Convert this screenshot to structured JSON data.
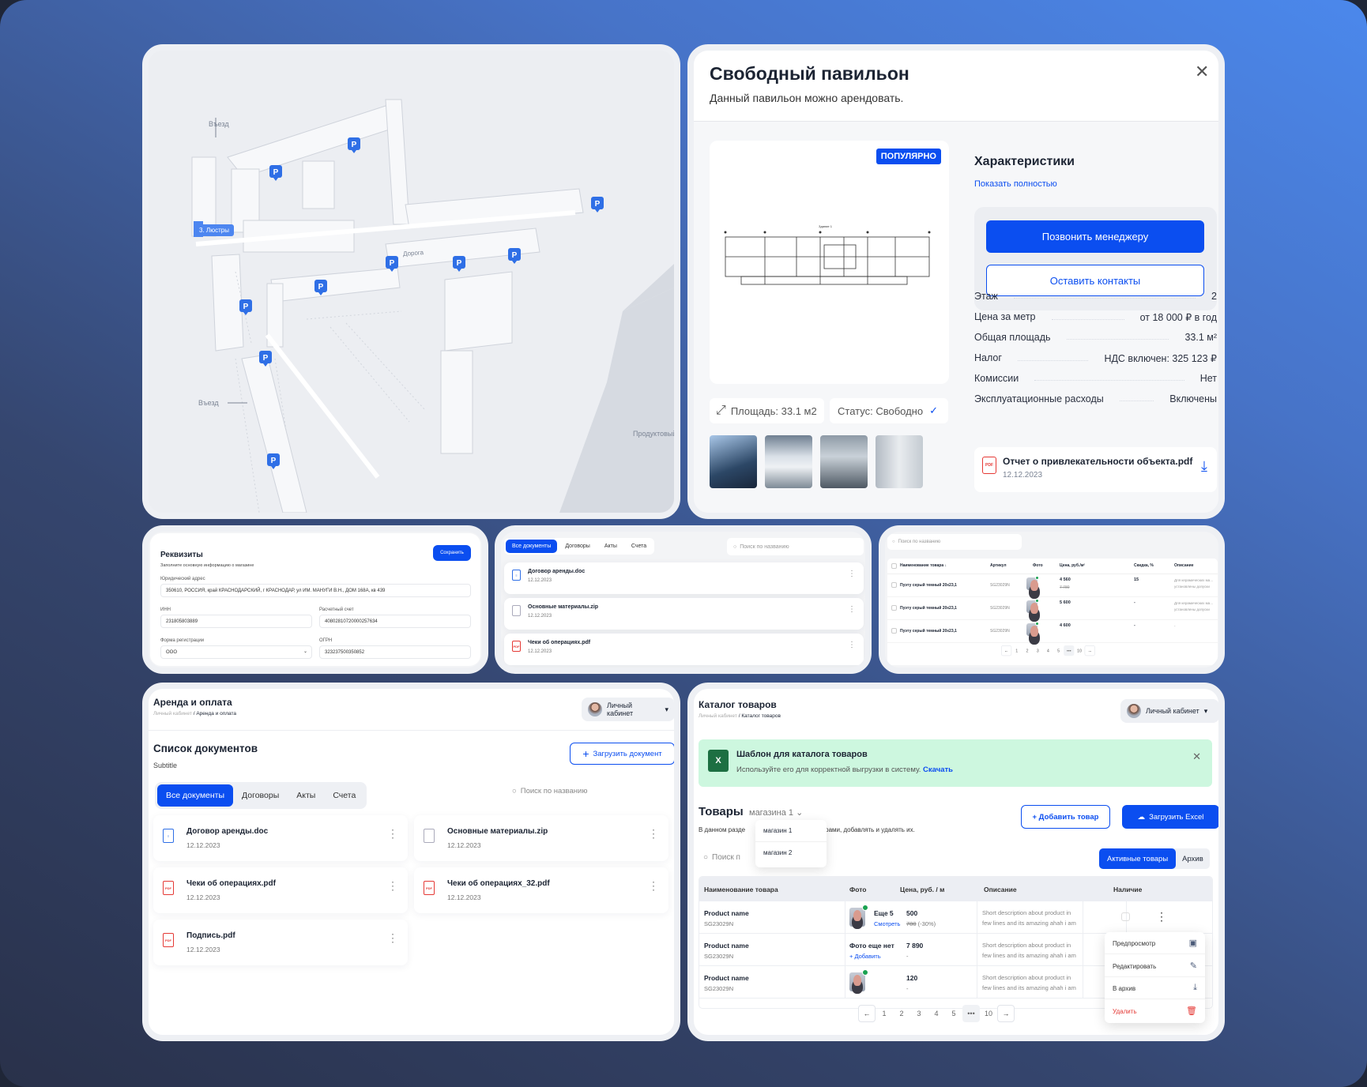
{
  "map": {
    "labels": {
      "entry_top": "Въезд",
      "entry_left": "Въезд",
      "road": "Дорога",
      "market": "Продуктовый р",
      "selected": "3. Люстры"
    },
    "pin_icon": "parking-icon"
  },
  "pavilion": {
    "title": "Свободный павильон",
    "subtitle": "Данный павильон можно арендовать.",
    "badge": "ПОПУЛЯРНО",
    "plan_title": "Здание 1",
    "area_chip": "Площадь: 33.1 м2",
    "status_chip": "Статус: Свободно",
    "specs_title": "Характеристики",
    "show_all": "Показать полностью",
    "call_button": "Позвонить менеджеру",
    "contacts_button": "Оставить контакты",
    "rows": [
      {
        "label": "Этаж",
        "value": "2"
      },
      {
        "label": "Цена за метр",
        "value": "от 18 000 ₽ в год"
      },
      {
        "label": "Общая площадь",
        "value": "33.1 м²"
      },
      {
        "label": "Налог",
        "value": "НДС включен: 325 123 ₽"
      },
      {
        "label": "Комиссии",
        "value": "Нет"
      },
      {
        "label": "Эксплуатационные расходы",
        "value": "Включены"
      }
    ],
    "file": {
      "name": "Отчет о привлекательности объекта.pdf",
      "date": "12.12.2023",
      "type": "PDF"
    }
  },
  "requisites": {
    "title": "Реквизиты",
    "subtitle": "Заполните основную информацию о магазине",
    "save": "Сохранить",
    "address_label": "Юридический адрес",
    "address": "350610, РОССИЯ, край КРАСНОДАРСКИЙ, г КРАСНОДАР, ул ИМ. МАНУГИ В.Н., ДОМ 168А, кв 439",
    "inn_label": "ИНН",
    "inn": "231805803889",
    "account_label": "Расчетный счет",
    "account": "40802810720000257634",
    "form_label": "Форма регистрации",
    "form": "ООО",
    "ogrn_label": "ОГРН",
    "ogrn": "323237500350852"
  },
  "docs_small": {
    "tabs": [
      "Все документы",
      "Договоры",
      "Акты",
      "Счета"
    ],
    "search_placeholder": "Поиск по названию",
    "items": [
      {
        "name": "Договор аренды.doc",
        "date": "12.12.2023",
        "type": "doc"
      },
      {
        "name": "Основные материалы.zip",
        "date": "12.12.2023",
        "type": "zip"
      },
      {
        "name": "Чеки об операциях.pdf",
        "date": "12.12.2023",
        "type": "pdf"
      }
    ]
  },
  "table_small": {
    "search_placeholder": "Поиск по названию",
    "headers": [
      "Наименование товара ↓",
      "Артикул",
      "Фото",
      "Цена, руб./м²",
      "Скидка, %",
      "Описание"
    ],
    "rows": [
      {
        "name": "Пуэту серый темный 20х23,1",
        "sku": "SG23029N",
        "price": "4 560",
        "old": "7 780",
        "discount": "15",
        "desc": "Для керамических ма… установлены допуски"
      },
      {
        "name": "Пуэту серый темный 20х23,1",
        "sku": "SG23029N",
        "price": "5 600",
        "old": "",
        "discount": "-",
        "desc": "Для керамических ма… установлены допуски"
      },
      {
        "name": "Пуэту серый темный 20х23,1",
        "sku": "SG23029N",
        "price": "4 600",
        "old": "",
        "discount": "-",
        "desc": "-"
      }
    ],
    "pages": [
      "←",
      "1",
      "2",
      "3",
      "4",
      "5",
      "•••",
      "10",
      "→"
    ]
  },
  "rent": {
    "title": "Аренда и оплата",
    "crumb_parent": "Личный кабинет",
    "crumb_current": "Аренда и оплата",
    "account_menu": "Личный кабинет",
    "list_title": "Список документов",
    "list_subtitle": "Subtitle",
    "upload": "Загрузить документ",
    "tabs": [
      "Все документы",
      "Договоры",
      "Акты",
      "Счета"
    ],
    "search_placeholder": "Поиск по названию",
    "docs": [
      {
        "name": "Договор аренды.doc",
        "date": "12.12.2023",
        "type": "doc"
      },
      {
        "name": "Основные материалы.zip",
        "date": "12.12.2023",
        "type": "zip"
      },
      {
        "name": "Чеки об операциях.pdf",
        "date": "12.12.2023",
        "type": "pdf"
      },
      {
        "name": "Чеки об операциях_32.pdf",
        "date": "12.12.2023",
        "type": "pdf"
      },
      {
        "name": "Подпись.pdf",
        "date": "12.12.2023",
        "type": "pdf"
      }
    ]
  },
  "catalog": {
    "title": "Каталог товаров",
    "crumb_parent": "Личный кабинет",
    "crumb_current": "Каталог товаров",
    "account_menu": "Личный кабинет",
    "banner_title": "Шаблон для каталога товаров",
    "banner_text": "Используйте его для корректной выгрузки в систему.",
    "banner_link": "Скачать",
    "section_title": "Товары",
    "store_select": "магазина 1",
    "store_options": [
      "магазин 1",
      "магазин 2"
    ],
    "section_desc_a": "В данном разде",
    "section_desc_b": "ь товарами, добавлять и удалять их.",
    "add_button": "+ Добавить товар",
    "excel_button": "Загрузить Excel",
    "search_placeholder": "Поиск п",
    "toggle": [
      "Активные товары",
      "Архив"
    ],
    "headers": [
      "Наименование товара",
      "Фото",
      "Цена, руб. / м",
      "Описание",
      "Наличие"
    ],
    "rows": [
      {
        "name": "Product name",
        "sku": "SG23029N",
        "photo_more": "Еще 5",
        "photo_link": "Смотреть",
        "price": "500",
        "old": "780",
        "sale": "(-30%)",
        "desc": "Short description about product in few lines and its amazing ahah i am to lazy t…"
      },
      {
        "name": "Product name",
        "sku": "SG23029N",
        "photo_more": "Фото еще нет",
        "photo_link": "+ Добавить",
        "price": "7 890",
        "old": "-",
        "sale": "",
        "desc": "Short description about product in few lines and its amazing ahah i am"
      },
      {
        "name": "Product name",
        "sku": "SG23029N",
        "photo_more": "",
        "photo_link": "",
        "price": "120",
        "old": "-",
        "sale": "",
        "desc": "Short description about product in few lines and its amazing ahah i am"
      }
    ],
    "pages": [
      "←",
      "1",
      "2",
      "3",
      "4",
      "5",
      "•••",
      "10",
      "→"
    ],
    "menu": [
      {
        "label": "Предпросмотр",
        "icon": "image-icon"
      },
      {
        "label": "Редактировать",
        "icon": "edit-icon"
      },
      {
        "label": "В архив",
        "icon": "archive-icon"
      },
      {
        "label": "Удалить",
        "icon": "trash-icon"
      }
    ],
    "colors": {
      "accent": "#0b4ef0",
      "banner": "#cdf7df",
      "danger": "#e53935"
    }
  }
}
